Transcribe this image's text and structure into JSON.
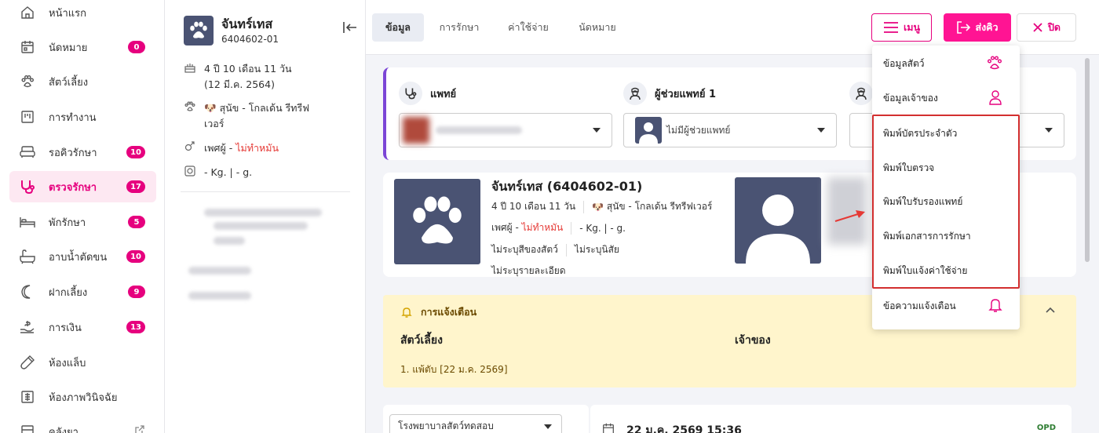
{
  "sidebar": {
    "items": [
      {
        "label": "หน้าแรก",
        "icon": "home-icon"
      },
      {
        "label": "นัดหมาย",
        "icon": "calendar-icon",
        "badge": "0"
      },
      {
        "label": "สัตว์เลี้ยง",
        "icon": "paw-icon"
      },
      {
        "label": "การทำงาน",
        "icon": "board-icon"
      },
      {
        "label": "รอคิวรักษา",
        "icon": "sofa-icon",
        "badge": "10"
      },
      {
        "label": "ตรวจรักษา",
        "icon": "stethoscope-icon",
        "badge": "17",
        "active": true
      },
      {
        "label": "พักรักษา",
        "icon": "bed-icon",
        "badge": "5"
      },
      {
        "label": "อาบน้ำตัดขน",
        "icon": "bathtub-icon",
        "badge": "10"
      },
      {
        "label": "ฝากเลี้ยง",
        "icon": "moon-icon",
        "badge": "9"
      },
      {
        "label": "การเงิน",
        "icon": "money-hand-icon",
        "badge": "13"
      },
      {
        "label": "ห้องแล็บ",
        "icon": "test-tube-icon"
      },
      {
        "label": "ห้องภาพวินิจฉัย",
        "icon": "xray-icon"
      },
      {
        "label": "คลังยา",
        "icon": "cabinet-icon"
      }
    ]
  },
  "pet_panel": {
    "name": "จันทร์เทส",
    "code": "6404602-01",
    "age_line1": "4 ปี 10 เดือน 11 วัน",
    "age_line2": "(12 มี.ค. 2564)",
    "species_line1": "สุนัข - โกลเด้น รีทรีฟ",
    "species_line2": "เวอร์",
    "sex_prefix": "เพศผู้ -",
    "sex_status": "ไม่ทำหมัน",
    "weight": "- Kg. | - g."
  },
  "tabs": [
    {
      "label": "ข้อมูล",
      "active": true
    },
    {
      "label": "การรักษา"
    },
    {
      "label": "ค่าใช้จ่าย"
    },
    {
      "label": "นัดหมาย"
    }
  ],
  "toolbar": {
    "menu_label": "เมนู",
    "send_label": "ส่งคิว",
    "close_label": "ปิด"
  },
  "staff": {
    "doctor_label": "แพทย์",
    "assistant1_label": "ผู้ช่วยแพทย์ 1",
    "assistant_placeholder": "ไม่มีผู้ช่วยแพทย์"
  },
  "pet_card": {
    "title": "จันทร์เทส (6404602-01)",
    "age": "4 ปี 10 เดือน 11 วัน",
    "species": "สุนัข - โกลเด้น รีทรีฟเวอร์",
    "sex_prefix": "เพศผู้ -",
    "sex_status": "ไม่ทำหมัน",
    "weight": "- Kg. | - g.",
    "color": "ไม่ระบุสีของสัตว์",
    "temperament": "ไม่ระบุนิสัย",
    "details": "ไม่ระบุรายละเอียด"
  },
  "alert": {
    "title": "การแจ้งเตือน",
    "col_pet": "สัตว์เลี้ยง",
    "col_owner": "เจ้าของ",
    "item": "1. แพ้ตับ [22 ม.ค. 2569]"
  },
  "bottom": {
    "hospital_select": "โรงพยาบาลสัตว์ทดสอบ",
    "date": "22 ม.ค. 2569 15:36",
    "visit_type": "OPD"
  },
  "dropdown": {
    "items": [
      {
        "label": "ข้อมูลสัตว์",
        "icon": "paw-icon"
      },
      {
        "label": "ข้อมูลเจ้าของ",
        "icon": "user-icon"
      },
      {
        "label": "พิมพ์บัตรประจำตัว"
      },
      {
        "label": "พิมพ์ใบตรวจ"
      },
      {
        "label": "พิมพ์ใบรับรองแพทย์"
      },
      {
        "label": "พิมพ์เอกสารการรักษา"
      },
      {
        "label": "พิมพ์ใบแจ้งค่าใช้จ่าย"
      },
      {
        "label": "ข้อความแจ้งเตือน",
        "icon": "bell-icon"
      }
    ]
  },
  "colors": {
    "accent": "#e6007e",
    "send_button": "#ff1493",
    "highlight_border": "#d32f2f",
    "alert_bg": "#fff5cc",
    "staff_border": "#7b45d6"
  }
}
